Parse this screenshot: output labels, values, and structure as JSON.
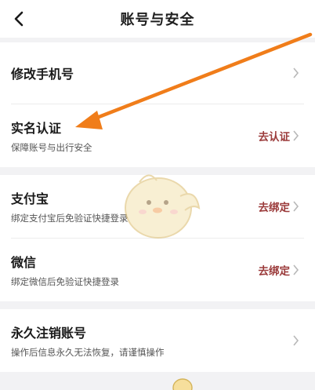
{
  "header": {
    "title": "账号与安全",
    "back_icon": "chevron-left-icon"
  },
  "rows": [
    {
      "name": "修改手机号",
      "sub": "",
      "action": ""
    },
    {
      "name": "实名认证",
      "sub": "保障账号与出行安全",
      "action": "去认证"
    },
    {
      "name": "支付宝",
      "sub": "绑定支付宝后免验证快捷登录",
      "action": "去绑定"
    },
    {
      "name": "微信",
      "sub": "绑定微信后免验证快捷登录",
      "action": "去绑定"
    },
    {
      "name": "永久注销账号",
      "sub": "操作后信息永久无法恢复，请谨慎操作",
      "action": ""
    }
  ],
  "colors": {
    "accent": "#9b3b3b",
    "arrow": "#f07d1a",
    "background": "#f2f2f4"
  },
  "icons": {
    "chevron": "chevron-right-icon",
    "annotation": "orange-arrow-icon",
    "watermark": "mascot-icon"
  }
}
